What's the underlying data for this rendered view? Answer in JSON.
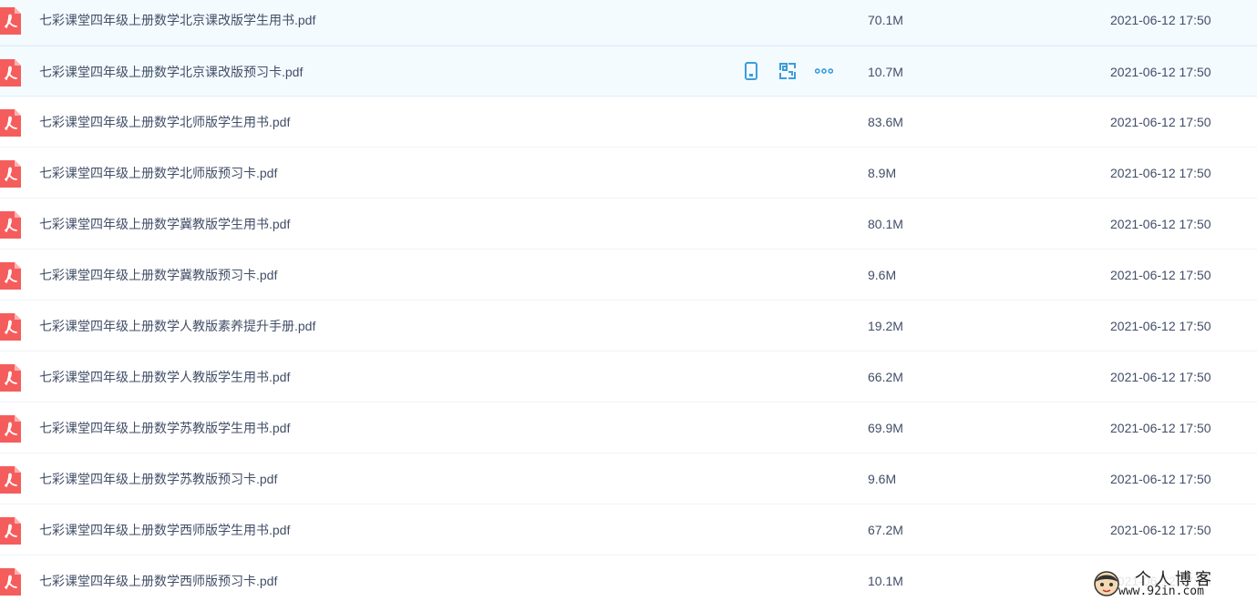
{
  "colors": {
    "pdf_red": "#f55d5d",
    "action_blue": "#3a9ddd",
    "hover_bg": "#f4fbff"
  },
  "icons": {
    "file": "pdf-icon",
    "actions": [
      "phone-icon",
      "share-icon",
      "more-icon"
    ]
  },
  "files": [
    {
      "name": "七彩课堂四年级上册数学北京课改版学生用书.pdf",
      "size": "70.1M",
      "date": "2021-06-12 17:50"
    },
    {
      "name": "七彩课堂四年级上册数学北京课改版预习卡.pdf",
      "size": "10.7M",
      "date": "2021-06-12 17:50"
    },
    {
      "name": "七彩课堂四年级上册数学北师版学生用书.pdf",
      "size": "83.6M",
      "date": "2021-06-12 17:50"
    },
    {
      "name": "七彩课堂四年级上册数学北师版预习卡.pdf",
      "size": "8.9M",
      "date": "2021-06-12 17:50"
    },
    {
      "name": "七彩课堂四年级上册数学冀教版学生用书.pdf",
      "size": "80.1M",
      "date": "2021-06-12 17:50"
    },
    {
      "name": "七彩课堂四年级上册数学冀教版预习卡.pdf",
      "size": "9.6M",
      "date": "2021-06-12 17:50"
    },
    {
      "name": "七彩课堂四年级上册数学人教版素养提升手册.pdf",
      "size": "19.2M",
      "date": "2021-06-12 17:50"
    },
    {
      "name": "七彩课堂四年级上册数学人教版学生用书.pdf",
      "size": "66.2M",
      "date": "2021-06-12 17:50"
    },
    {
      "name": "七彩课堂四年级上册数学苏教版学生用书.pdf",
      "size": "69.9M",
      "date": "2021-06-12 17:50"
    },
    {
      "name": "七彩课堂四年级上册数学苏教版预习卡.pdf",
      "size": "9.6M",
      "date": "2021-06-12 17:50"
    },
    {
      "name": "七彩课堂四年级上册数学西师版学生用书.pdf",
      "size": "67.2M",
      "date": "2021-06-12 17:50"
    },
    {
      "name": "七彩课堂四年级上册数学西师版预习卡.pdf",
      "size": "10.1M",
      "date": "2021-06-12 17:50"
    }
  ],
  "watermark": {
    "title": "个人博客",
    "url": "www.92in.com"
  }
}
